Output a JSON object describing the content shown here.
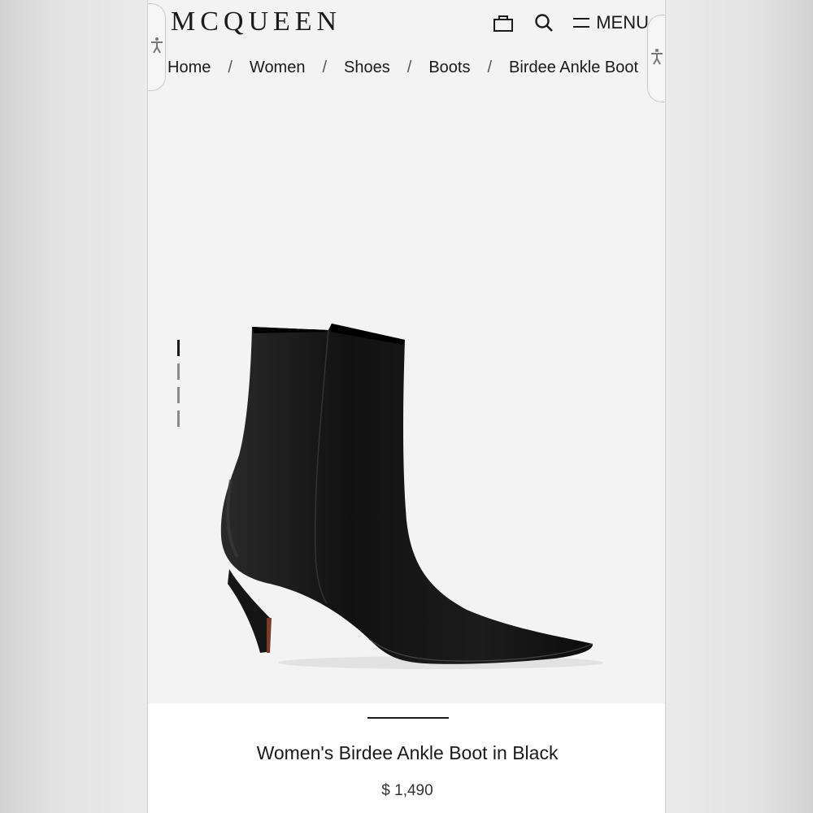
{
  "brand": {
    "logo_text": "MCQUEEN"
  },
  "header": {
    "menu_label": "MENU",
    "icons": [
      "shopping-bag-icon",
      "search-icon",
      "hamburger-icon"
    ]
  },
  "breadcrumb": {
    "items": [
      "Home",
      "Women",
      "Shoes",
      "Boots",
      "Birdee Ankle Boot"
    ],
    "separator": "/"
  },
  "gallery": {
    "image_count": 4,
    "active_index": 0
  },
  "product": {
    "name": "Women's Birdee Ankle Boot in Black",
    "price": "$ 1,490"
  },
  "colors": {
    "text": "#1a1a1a",
    "page_bg": "#f3f3f3",
    "info_bg": "#ffffff"
  }
}
